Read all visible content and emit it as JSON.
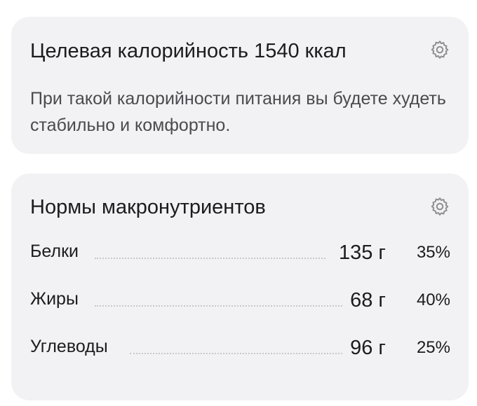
{
  "calorie_card": {
    "title": "Целевая калорийность 1540 ккал",
    "description": "При такой калорийности питания вы будете худеть стабильно и комфортно.",
    "settings_icon": "gear-icon"
  },
  "macros_card": {
    "title": "Нормы макронутриентов",
    "settings_icon": "gear-icon",
    "items": [
      {
        "name": "Белки",
        "grams": "135 г",
        "percent": "35%"
      },
      {
        "name": "Жиры",
        "grams": "68 г",
        "percent": "40%"
      },
      {
        "name": "Углеводы",
        "grams": "96 г",
        "percent": "25%"
      }
    ]
  },
  "colors": {
    "card_background": "#f2f2f4",
    "text_primary": "#1c1c1e",
    "text_secondary": "#4a4a4f",
    "dots": "#c8c8cc"
  }
}
